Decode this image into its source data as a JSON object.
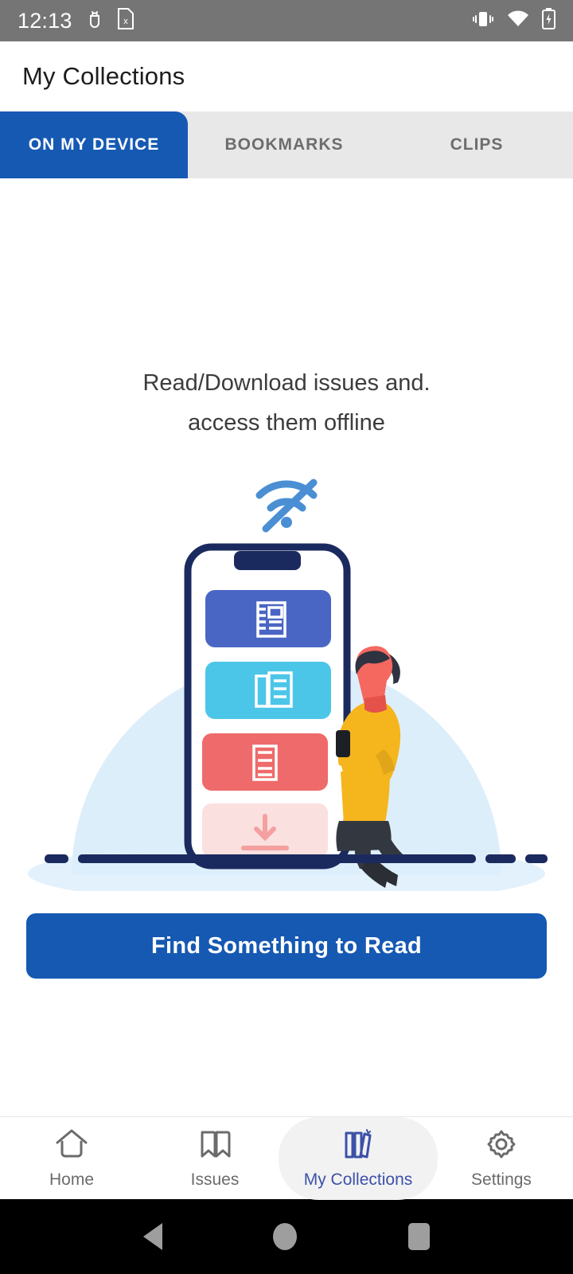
{
  "status_bar": {
    "time": "12:13",
    "left_icons": [
      "android-debug-icon",
      "sim-card-x-icon"
    ],
    "right_icons": [
      "vibrate-icon",
      "wifi-icon",
      "battery-charging-icon"
    ],
    "background": "#757575"
  },
  "appbar": {
    "title": "My Collections"
  },
  "tabs": {
    "active_index": 0,
    "active_color": "#1559b3",
    "items": [
      {
        "label": "ON MY DEVICE"
      },
      {
        "label": "BOOKMARKS"
      },
      {
        "label": "CLIPS"
      }
    ]
  },
  "empty_state": {
    "line1": "Read/Download issues and.",
    "line2": "access them offline",
    "offline_icon": "wifi-off-icon",
    "illustration": {
      "name": "offline-reading-illustration",
      "arch_color": "#ddeefb",
      "phone_frame_color": "#1b2a5e",
      "cards": [
        {
          "name": "article-card-blue",
          "color": "#4a66c4",
          "icon": "newspaper-icon"
        },
        {
          "name": "article-card-cyan",
          "color": "#4cc6e8",
          "icon": "newspaper-icon"
        },
        {
          "name": "article-card-red",
          "color": "#ef6a6a",
          "icon": "document-icon"
        },
        {
          "name": "download-card-pink",
          "color": "#fbe0e0",
          "icon": "download-icon"
        }
      ],
      "person": {
        "hair_color": "#2f3240",
        "face_color": "#f4685f",
        "shirt_color": "#f5b51c",
        "pants_color": "#33373f",
        "phone_color": "#1d1f26"
      },
      "ground_color": "#1b2a5e"
    }
  },
  "cta": {
    "label": "Find Something to Read",
    "color": "#1559b3"
  },
  "bottom_nav": {
    "active_index": 2,
    "active_color": "#3c51a8",
    "items": [
      {
        "label": "Home",
        "icon": "home-icon"
      },
      {
        "label": "Issues",
        "icon": "open-book-icon"
      },
      {
        "label": "My Collections",
        "icon": "books-shelf-icon"
      },
      {
        "label": "Settings",
        "icon": "gear-icon"
      }
    ]
  },
  "system_nav": {
    "back": "back-triangle-icon",
    "home": "home-circle-icon",
    "recents": "recents-square-icon"
  }
}
